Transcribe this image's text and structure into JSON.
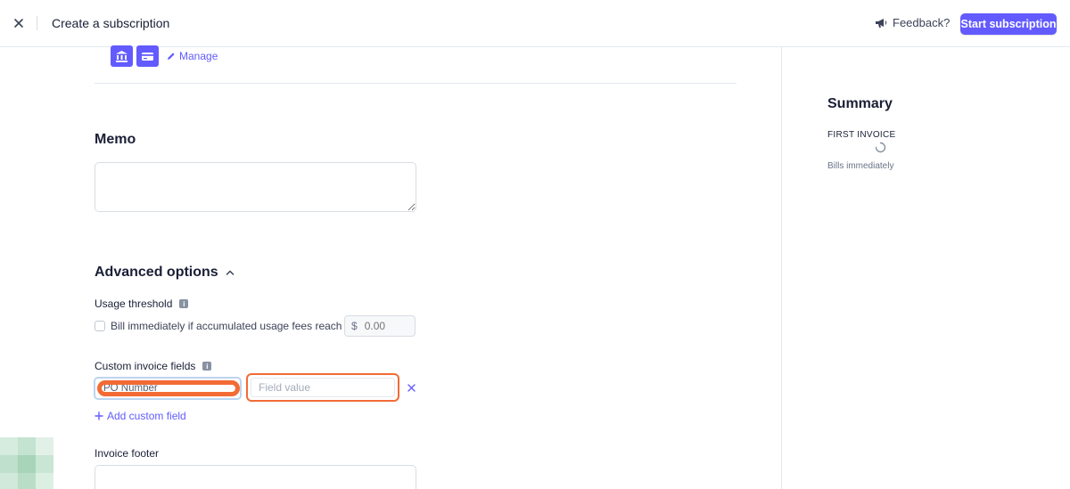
{
  "header": {
    "title": "Create a subscription",
    "feedback_label": "Feedback?",
    "start_label": "Start subscription"
  },
  "payment": {
    "icons": [
      "bank-icon",
      "card-icon"
    ],
    "manage_label": "Manage"
  },
  "memo": {
    "title": "Memo",
    "value": ""
  },
  "advanced": {
    "title": "Advanced options",
    "usage_threshold": {
      "label": "Usage threshold",
      "checkbox_label": "Bill immediately if accumulated usage fees reach",
      "currency": "$",
      "placeholder": "0.00",
      "checked": false
    },
    "custom_fields": {
      "label": "Custom invoice fields",
      "name_value": "PO Number",
      "value_placeholder": "Field value",
      "add_label": "Add custom field"
    },
    "invoice_footer": {
      "label": "Invoice footer",
      "value": ""
    }
  },
  "summary": {
    "title": "Summary",
    "first_invoice_label": "FIRST INVOICE",
    "bills_label": "Bills immediately"
  },
  "colors": {
    "accent": "#635bff",
    "highlight": "#f26b35",
    "text": "#1a1f36",
    "muted": "#697386",
    "border": "#e3e8ee"
  }
}
